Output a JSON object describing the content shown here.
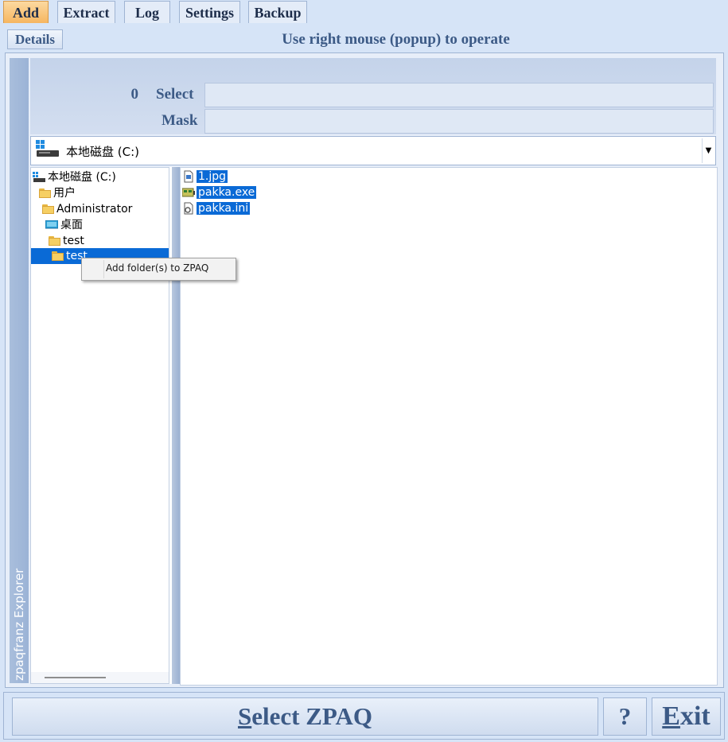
{
  "tabs": [
    {
      "label": "Add",
      "active": true
    },
    {
      "label": "Extract",
      "active": false
    },
    {
      "label": "Log",
      "active": false
    },
    {
      "label": "Settings",
      "active": false
    },
    {
      "label": "Backup",
      "active": false
    }
  ],
  "header": {
    "details_label": "Details",
    "hint": "Use right mouse (popup) to operate"
  },
  "sidebar_title": "zpaqfranz Explorer",
  "filter": {
    "count": "0",
    "select_label": "Select",
    "mask_label": "Mask",
    "select_value": "",
    "mask_value": ""
  },
  "drive": {
    "label": "本地磁盘 (C:)"
  },
  "tree": [
    {
      "label": "本地磁盘 (C:)",
      "icon": "drive-icon",
      "selected": false
    },
    {
      "label": "用户",
      "icon": "folder-icon",
      "selected": false
    },
    {
      "label": "Administrator",
      "icon": "folder-icon",
      "selected": false
    },
    {
      "label": "桌面",
      "icon": "desktop-icon",
      "selected": false
    },
    {
      "label": "test",
      "icon": "folder-icon",
      "selected": false
    },
    {
      "label": "test",
      "icon": "folder-icon",
      "selected": true
    }
  ],
  "files": [
    {
      "name": "1.jpg",
      "icon": "image-file-icon"
    },
    {
      "name": "pakka.exe",
      "icon": "exe-file-icon"
    },
    {
      "name": "pakka.ini",
      "icon": "settings-file-icon"
    }
  ],
  "context_menu": {
    "item": "Add folder(s) to ZPAQ"
  },
  "bottom": {
    "select_first": "S",
    "select_rest": "elect ZPAQ",
    "help": "?",
    "exit_first": "E",
    "exit_rest": "xit"
  },
  "colors": {
    "accent": "#0a6ad6",
    "active_tab": "#f6b660",
    "label_text": "#3c5a86",
    "background": "#d6e4f7"
  }
}
